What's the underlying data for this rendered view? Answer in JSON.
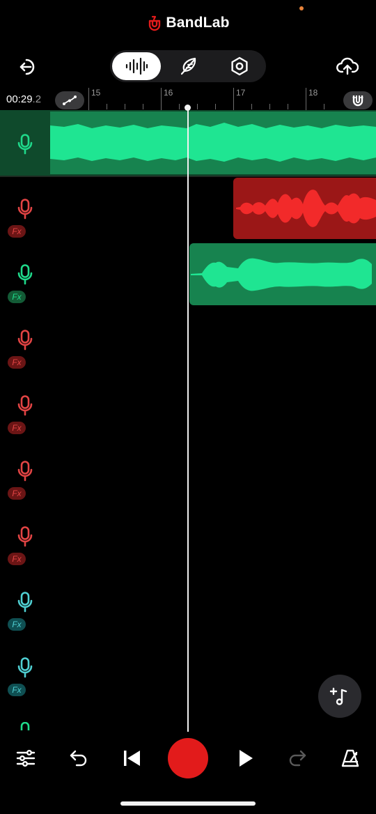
{
  "app": {
    "title": "BandLab",
    "brand_color": "#e21b1b"
  },
  "toolbar": {
    "exit_icon": "exit-icon",
    "upload_icon": "cloud-upload-icon",
    "modes": [
      {
        "name": "tracks",
        "icon": "waveform-icon",
        "active": true
      },
      {
        "name": "lyrics",
        "icon": "feather-icon",
        "active": false
      },
      {
        "name": "settings",
        "icon": "hexagon-nut-icon",
        "active": false
      }
    ]
  },
  "timeline": {
    "time_main": "00:29",
    "time_decimal": ".2",
    "bars": [
      "15",
      "16",
      "17",
      "18"
    ]
  },
  "tracks": [
    {
      "color": "#1fd98a",
      "fx": false,
      "selected": true
    },
    {
      "color": "#e24444",
      "fx": true,
      "fx_label": "Fx"
    },
    {
      "color": "#1fd98a",
      "fx": true,
      "fx_label": "Fx"
    },
    {
      "color": "#e24444",
      "fx": true,
      "fx_label": "Fx"
    },
    {
      "color": "#e24444",
      "fx": true,
      "fx_label": "Fx"
    },
    {
      "color": "#e24444",
      "fx": true,
      "fx_label": "Fx"
    },
    {
      "color": "#e24444",
      "fx": true,
      "fx_label": "Fx"
    },
    {
      "color": "#4fcfd2",
      "fx": true,
      "fx_label": "Fx"
    },
    {
      "color": "#4fcfd2",
      "fx": true,
      "fx_label": "Fx"
    }
  ],
  "bottom_bar": {
    "mixer_icon": "sliders-icon",
    "undo_icon": "undo-icon",
    "rewind_icon": "skip-back-icon",
    "record_icon": "record-icon",
    "play_icon": "play-icon",
    "redo_icon": "redo-icon",
    "metronome_icon": "metronome-icon"
  },
  "add_note_icon": "add-note-icon"
}
